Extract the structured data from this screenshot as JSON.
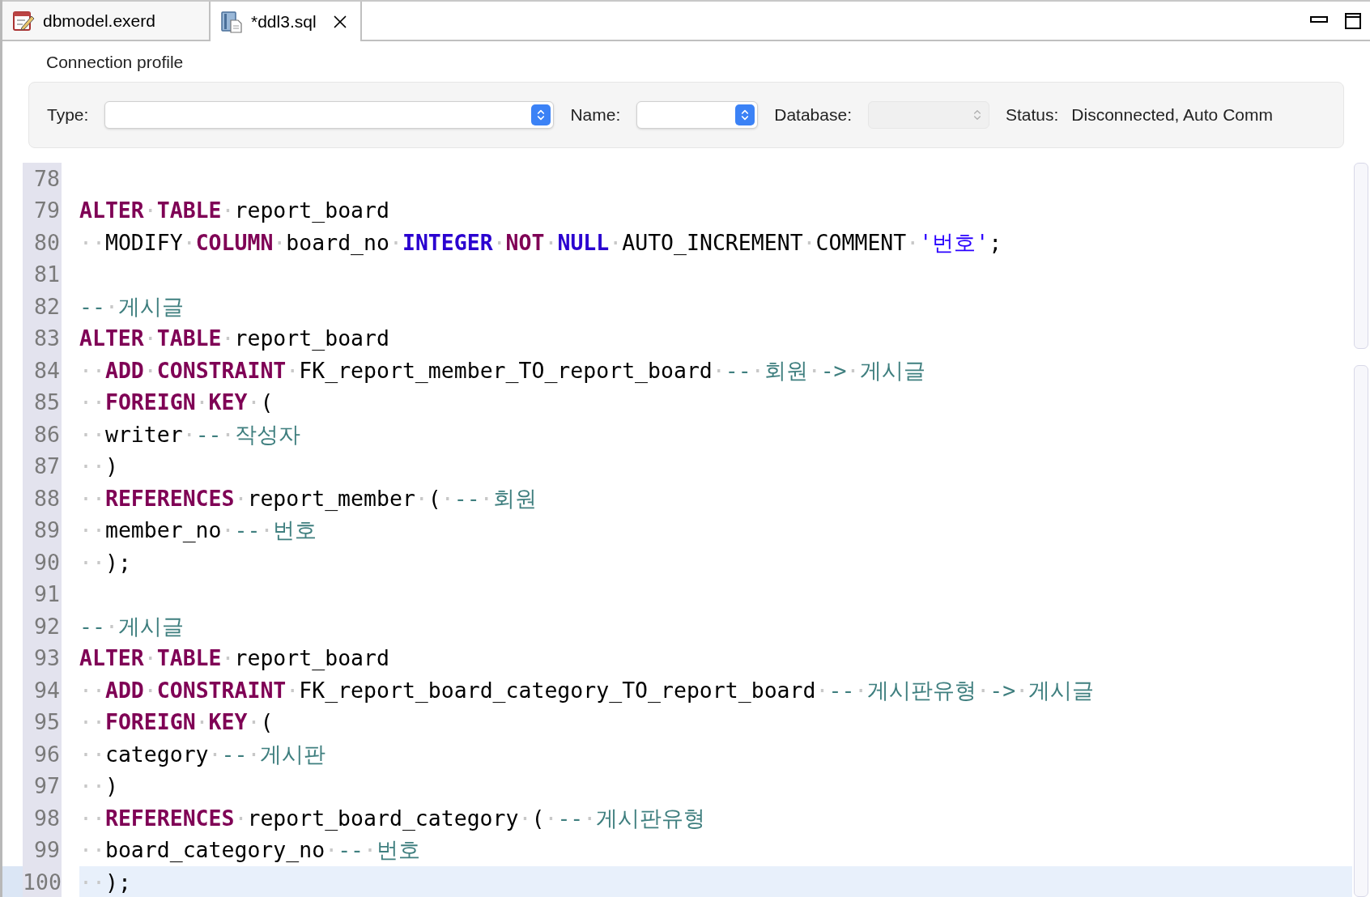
{
  "tabs": [
    {
      "label": "dbmodel.exerd",
      "kind": "diagram",
      "selected": false
    },
    {
      "label": "*ddl3.sql",
      "kind": "sql",
      "selected": true
    }
  ],
  "connection": {
    "title": "Connection profile",
    "fields": [
      {
        "label": "Type:",
        "disabled": false,
        "kind": "wide"
      },
      {
        "label": "Name:",
        "disabled": false,
        "kind": "narrow"
      },
      {
        "label": "Database:",
        "disabled": true,
        "kind": "narrow"
      }
    ],
    "status": {
      "label": "Status:",
      "value": "Disconnected, Auto Comm"
    }
  },
  "editor": {
    "lines": [
      {
        "number": "78",
        "current": false
      },
      {
        "number": "79",
        "current": false,
        "segments": [
          {
            "kind": "kw",
            "text": "ALTER"
          },
          {
            "kind": "ws",
            "text": "·"
          },
          {
            "kind": "kw",
            "text": "TABLE"
          },
          {
            "kind": "ws",
            "text": "·"
          },
          {
            "kind": "plain",
            "text": "report_board"
          }
        ]
      },
      {
        "number": "80",
        "current": false,
        "segments": [
          {
            "kind": "ws",
            "text": "··"
          },
          {
            "kind": "plain",
            "text": "MODIFY"
          },
          {
            "kind": "ws",
            "text": "·"
          },
          {
            "kind": "kw",
            "text": "COLUMN"
          },
          {
            "kind": "ws",
            "text": "·"
          },
          {
            "kind": "plain",
            "text": "board_no"
          },
          {
            "kind": "ws",
            "text": "·"
          },
          {
            "kind": "type",
            "text": "INTEGER"
          },
          {
            "kind": "ws",
            "text": "·"
          },
          {
            "kind": "kw",
            "text": "NOT"
          },
          {
            "kind": "ws",
            "text": "·"
          },
          {
            "kind": "type",
            "text": "NULL"
          },
          {
            "kind": "ws",
            "text": "·"
          },
          {
            "kind": "plain",
            "text": "AUTO_INCREMENT"
          },
          {
            "kind": "ws",
            "text": "·"
          },
          {
            "kind": "plain",
            "text": "COMMENT"
          },
          {
            "kind": "ws",
            "text": "·"
          },
          {
            "kind": "string",
            "text": "'번호'"
          },
          {
            "kind": "plain",
            "text": ";"
          }
        ]
      },
      {
        "number": "81",
        "current": false
      },
      {
        "number": "82",
        "current": false,
        "segments": [
          {
            "kind": "comment",
            "text": "--"
          },
          {
            "kind": "ws",
            "text": "·"
          },
          {
            "kind": "comment",
            "text": "게시글"
          }
        ]
      },
      {
        "number": "83",
        "current": false,
        "segments": [
          {
            "kind": "kw",
            "text": "ALTER"
          },
          {
            "kind": "ws",
            "text": "·"
          },
          {
            "kind": "kw",
            "text": "TABLE"
          },
          {
            "kind": "ws",
            "text": "·"
          },
          {
            "kind": "plain",
            "text": "report_board"
          }
        ]
      },
      {
        "number": "84",
        "current": false,
        "segments": [
          {
            "kind": "ws",
            "text": "··"
          },
          {
            "kind": "kw",
            "text": "ADD"
          },
          {
            "kind": "ws",
            "text": "·"
          },
          {
            "kind": "kw",
            "text": "CONSTRAINT"
          },
          {
            "kind": "ws",
            "text": "·"
          },
          {
            "kind": "plain",
            "text": "FK_report_member_TO_report_board"
          },
          {
            "kind": "ws",
            "text": "·"
          },
          {
            "kind": "comment",
            "text": "--"
          },
          {
            "kind": "ws",
            "text": "·"
          },
          {
            "kind": "comment",
            "text": "회원"
          },
          {
            "kind": "ws",
            "text": "·"
          },
          {
            "kind": "comment",
            "text": "->"
          },
          {
            "kind": "ws",
            "text": "·"
          },
          {
            "kind": "comment",
            "text": "게시글"
          }
        ]
      },
      {
        "number": "85",
        "current": false,
        "segments": [
          {
            "kind": "ws",
            "text": "··"
          },
          {
            "kind": "kw",
            "text": "FOREIGN"
          },
          {
            "kind": "ws",
            "text": "·"
          },
          {
            "kind": "kw",
            "text": "KEY"
          },
          {
            "kind": "ws",
            "text": "·"
          },
          {
            "kind": "plain",
            "text": "("
          }
        ]
      },
      {
        "number": "86",
        "current": false,
        "segments": [
          {
            "kind": "ws",
            "text": "··"
          },
          {
            "kind": "plain",
            "text": "writer"
          },
          {
            "kind": "ws",
            "text": "·"
          },
          {
            "kind": "comment",
            "text": "--"
          },
          {
            "kind": "ws",
            "text": "·"
          },
          {
            "kind": "comment",
            "text": "작성자"
          }
        ]
      },
      {
        "number": "87",
        "current": false,
        "segments": [
          {
            "kind": "ws",
            "text": "··"
          },
          {
            "kind": "plain",
            "text": ")"
          }
        ]
      },
      {
        "number": "88",
        "current": false,
        "segments": [
          {
            "kind": "ws",
            "text": "··"
          },
          {
            "kind": "kw",
            "text": "REFERENCES"
          },
          {
            "kind": "ws",
            "text": "·"
          },
          {
            "kind": "plain",
            "text": "report_member"
          },
          {
            "kind": "ws",
            "text": "·"
          },
          {
            "kind": "plain",
            "text": "("
          },
          {
            "kind": "ws",
            "text": "·"
          },
          {
            "kind": "comment",
            "text": "--"
          },
          {
            "kind": "ws",
            "text": "·"
          },
          {
            "kind": "comment",
            "text": "회원"
          }
        ]
      },
      {
        "number": "89",
        "current": false,
        "segments": [
          {
            "kind": "ws",
            "text": "··"
          },
          {
            "kind": "plain",
            "text": "member_no"
          },
          {
            "kind": "ws",
            "text": "·"
          },
          {
            "kind": "comment",
            "text": "--"
          },
          {
            "kind": "ws",
            "text": "·"
          },
          {
            "kind": "comment",
            "text": "번호"
          }
        ]
      },
      {
        "number": "90",
        "current": false,
        "segments": [
          {
            "kind": "ws",
            "text": "··"
          },
          {
            "kind": "plain",
            "text": ");"
          }
        ]
      },
      {
        "number": "91",
        "current": false
      },
      {
        "number": "92",
        "current": false,
        "segments": [
          {
            "kind": "comment",
            "text": "--"
          },
          {
            "kind": "ws",
            "text": "·"
          },
          {
            "kind": "comment",
            "text": "게시글"
          }
        ]
      },
      {
        "number": "93",
        "current": false,
        "segments": [
          {
            "kind": "kw",
            "text": "ALTER"
          },
          {
            "kind": "ws",
            "text": "·"
          },
          {
            "kind": "kw",
            "text": "TABLE"
          },
          {
            "kind": "ws",
            "text": "·"
          },
          {
            "kind": "plain",
            "text": "report_board"
          }
        ]
      },
      {
        "number": "94",
        "current": false,
        "segments": [
          {
            "kind": "ws",
            "text": "··"
          },
          {
            "kind": "kw",
            "text": "ADD"
          },
          {
            "kind": "ws",
            "text": "·"
          },
          {
            "kind": "kw",
            "text": "CONSTRAINT"
          },
          {
            "kind": "ws",
            "text": "·"
          },
          {
            "kind": "plain",
            "text": "FK_report_board_category_TO_report_board"
          },
          {
            "kind": "ws",
            "text": "·"
          },
          {
            "kind": "comment",
            "text": "--"
          },
          {
            "kind": "ws",
            "text": "·"
          },
          {
            "kind": "comment",
            "text": "게시판유형"
          },
          {
            "kind": "ws",
            "text": "·"
          },
          {
            "kind": "comment",
            "text": "->"
          },
          {
            "kind": "ws",
            "text": "·"
          },
          {
            "kind": "comment",
            "text": "게시글"
          }
        ]
      },
      {
        "number": "95",
        "current": false,
        "segments": [
          {
            "kind": "ws",
            "text": "··"
          },
          {
            "kind": "kw",
            "text": "FOREIGN"
          },
          {
            "kind": "ws",
            "text": "·"
          },
          {
            "kind": "kw",
            "text": "KEY"
          },
          {
            "kind": "ws",
            "text": "·"
          },
          {
            "kind": "plain",
            "text": "("
          }
        ]
      },
      {
        "number": "96",
        "current": false,
        "segments": [
          {
            "kind": "ws",
            "text": "··"
          },
          {
            "kind": "plain",
            "text": "category"
          },
          {
            "kind": "ws",
            "text": "·"
          },
          {
            "kind": "comment",
            "text": "--"
          },
          {
            "kind": "ws",
            "text": "·"
          },
          {
            "kind": "comment",
            "text": "게시판"
          }
        ]
      },
      {
        "number": "97",
        "current": false,
        "segments": [
          {
            "kind": "ws",
            "text": "··"
          },
          {
            "kind": "plain",
            "text": ")"
          }
        ]
      },
      {
        "number": "98",
        "current": false,
        "segments": [
          {
            "kind": "ws",
            "text": "··"
          },
          {
            "kind": "kw",
            "text": "REFERENCES"
          },
          {
            "kind": "ws",
            "text": "·"
          },
          {
            "kind": "plain",
            "text": "report_board_category"
          },
          {
            "kind": "ws",
            "text": "·"
          },
          {
            "kind": "plain",
            "text": "("
          },
          {
            "kind": "ws",
            "text": "·"
          },
          {
            "kind": "comment",
            "text": "--"
          },
          {
            "kind": "ws",
            "text": "·"
          },
          {
            "kind": "comment",
            "text": "게시판유형"
          }
        ]
      },
      {
        "number": "99",
        "current": false,
        "segments": [
          {
            "kind": "ws",
            "text": "··"
          },
          {
            "kind": "plain",
            "text": "board_category_no"
          },
          {
            "kind": "ws",
            "text": "·"
          },
          {
            "kind": "comment",
            "text": "--"
          },
          {
            "kind": "ws",
            "text": "·"
          },
          {
            "kind": "comment",
            "text": "번호"
          }
        ]
      },
      {
        "number": "100",
        "current": true,
        "segments": [
          {
            "kind": "ws",
            "text": "··"
          },
          {
            "kind": "plain",
            "text": ");"
          }
        ]
      }
    ]
  }
}
